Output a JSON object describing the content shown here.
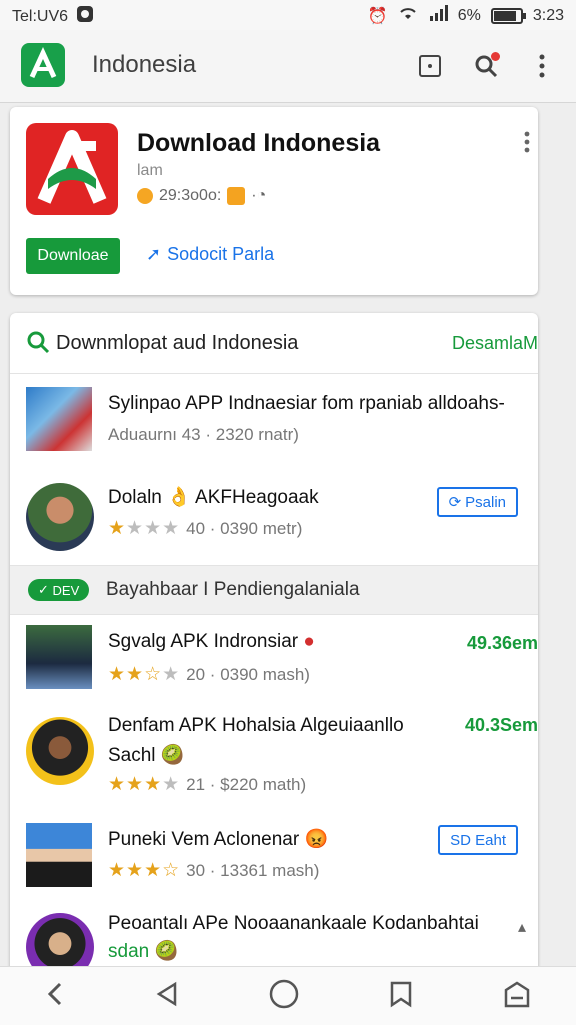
{
  "status": {
    "left_text": "Tel:UV6",
    "battery": "6%",
    "time": "3:23"
  },
  "appbar": {
    "title": "Indonesia"
  },
  "app": {
    "name": "Download Indonesia",
    "developer": "lam",
    "rating_text": "29:3o0o:",
    "download_label": "Downloae",
    "subscribe_label": "Sodocit Parla"
  },
  "list": {
    "search_text": "Downmlopat aud Indonesia",
    "more_label": "DesamlaM",
    "items": [
      {
        "title": "Sylinpao APP Indnaesiar fom rpaniab alldoahs-",
        "meta": "Aduaurnı 43 · 2320 rnatr)"
      },
      {
        "title": "Dolaln 👌 AKFHeagoaak",
        "rating": 1,
        "meta": "40 · 0390 metr)",
        "action": "Psalin"
      }
    ],
    "section": {
      "badge": "DEV",
      "title": "Bayahbaar I Pendiengalaniala"
    },
    "items2": [
      {
        "title": "Sgvalg APK Indronsiar",
        "rating": 2.5,
        "meta": "20 · 0390 mash)",
        "price": "49.36em"
      },
      {
        "title": "Denfam APK Hohalsia Algeuiaanllo",
        "title2": "Sachl",
        "rating": 3,
        "meta": "21 · $220 math)",
        "price": "40.3Sem"
      },
      {
        "title": "Puneki Vem Aclonenar",
        "rating": 3.5,
        "meta": "30 · 13361 mash)",
        "action": "SD Eaht"
      },
      {
        "title": "Peoantalı APe Nooaanankaale Kodanbahtai",
        "title2": "sdan"
      }
    ]
  }
}
